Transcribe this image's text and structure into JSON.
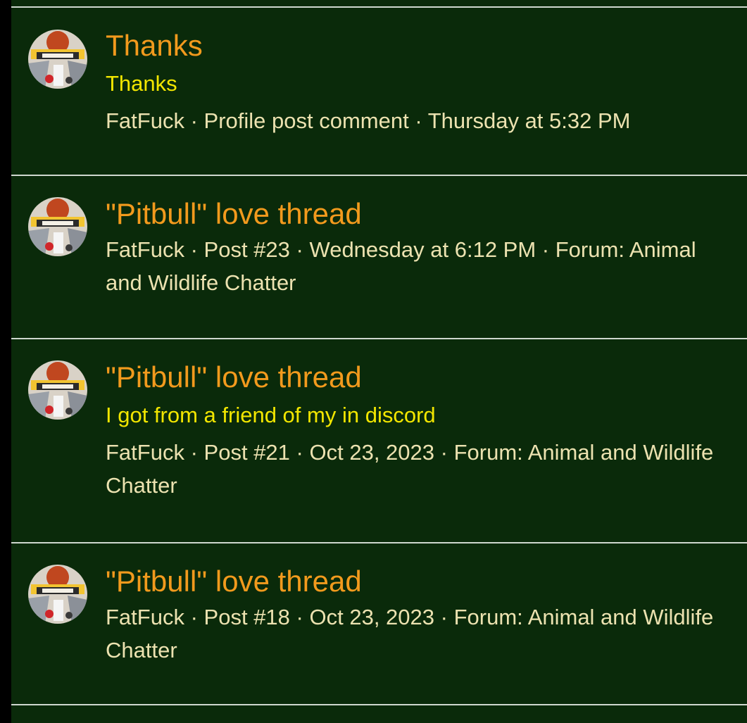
{
  "results": [
    {
      "title": "Thanks",
      "snippet": "Thanks",
      "author": "FatFuck",
      "type": "Profile post comment",
      "time": "Thursday at 5:32 PM",
      "forum_prefix": "",
      "forum": ""
    },
    {
      "title": "\"Pitbull\" love thread",
      "snippet": "",
      "author": "FatFuck",
      "type": "Post #23",
      "time": "Wednesday at 6:12 PM",
      "forum_prefix": "Forum:",
      "forum": "Animal and Wildlife Chatter"
    },
    {
      "title": "\"Pitbull\" love thread",
      "snippet": "I got from a friend of my in discord",
      "author": "FatFuck",
      "type": "Post #21",
      "time": "Oct 23, 2023",
      "forum_prefix": "Forum:",
      "forum": "Animal and Wildlife Chatter"
    },
    {
      "title": "\"Pitbull\" love thread",
      "snippet": "",
      "author": "FatFuck",
      "type": "Post #18",
      "time": "Oct 23, 2023",
      "forum_prefix": "Forum:",
      "forum": "Animal and Wildlife Chatter"
    }
  ],
  "separator": "·",
  "icons": {
    "avatar": "user-avatar-icon"
  },
  "colors": {
    "background": "#0a2a0a",
    "title": "#f29a1d",
    "snippet": "#f2e600",
    "meta": "#ece2b0",
    "divider": "#cfd8cf"
  }
}
